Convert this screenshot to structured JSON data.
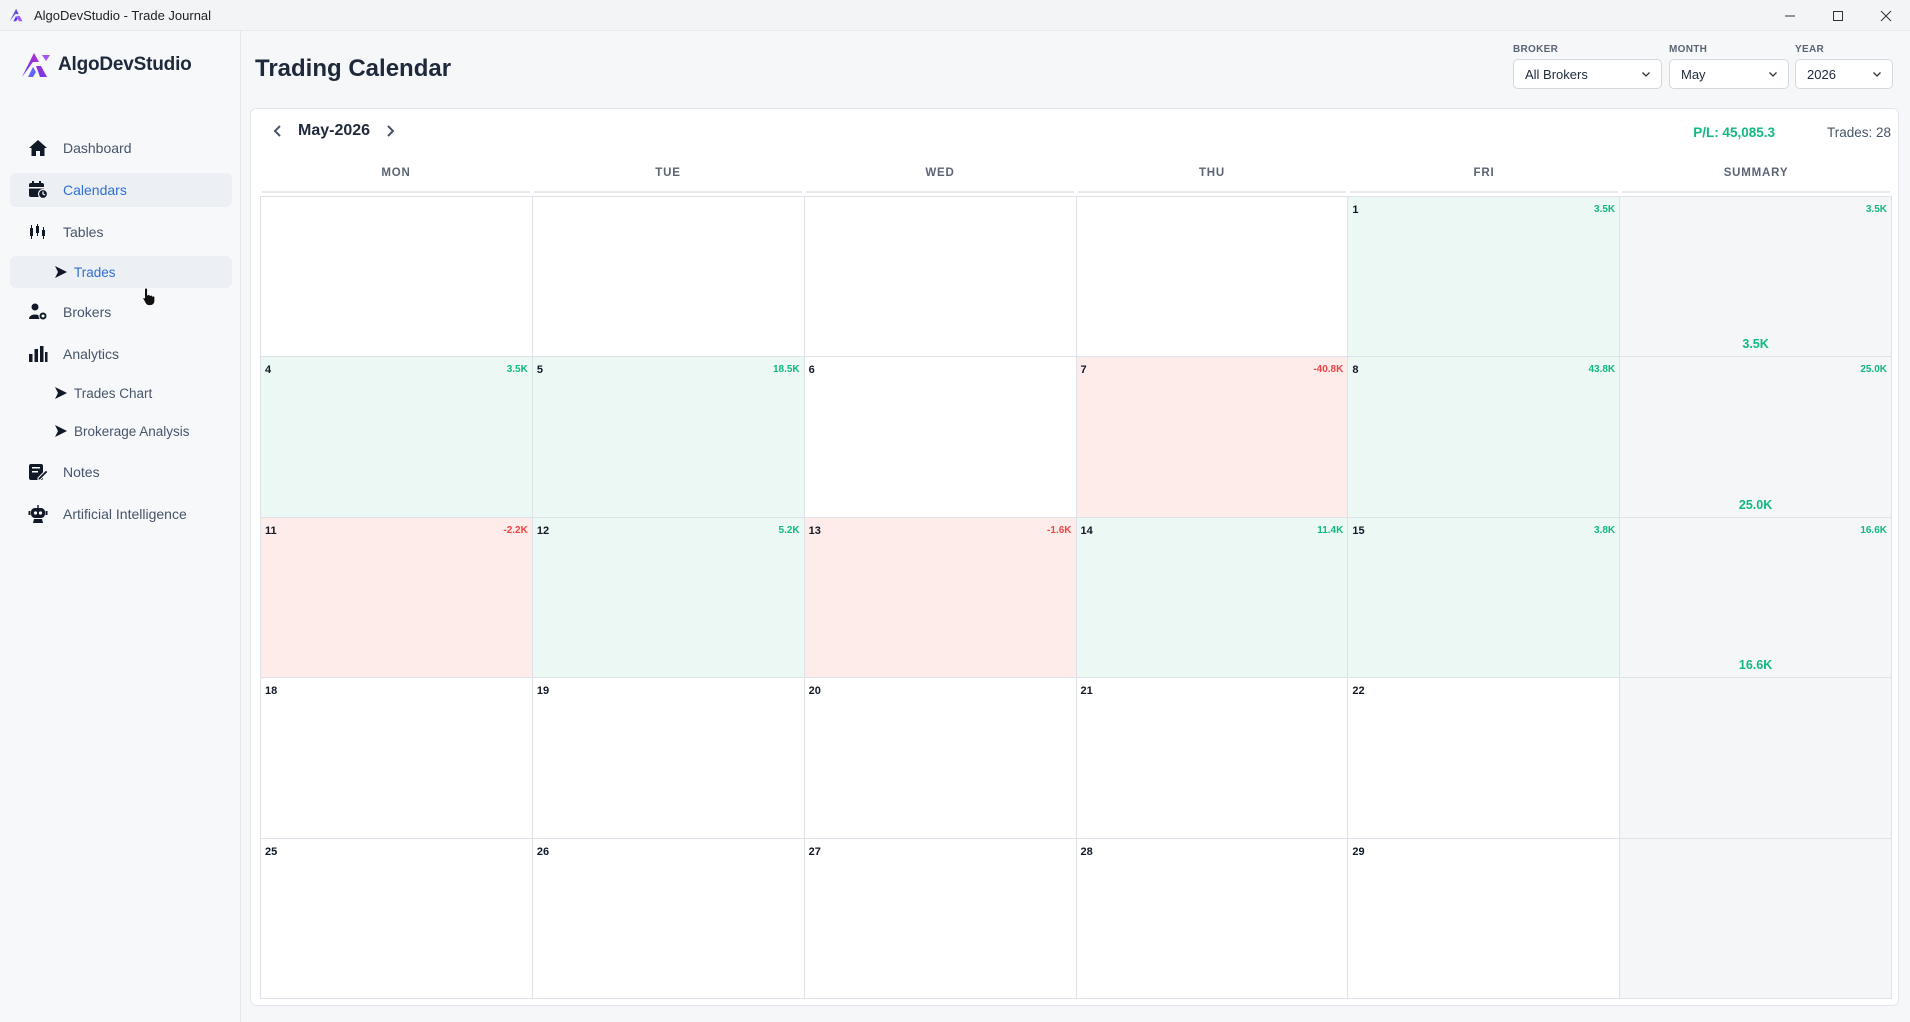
{
  "window": {
    "title": "AlgoDevStudio - Trade Journal"
  },
  "brand": {
    "name": "AlgoDevStudio"
  },
  "sidebar": {
    "items": [
      {
        "label": "Dashboard"
      },
      {
        "label": "Calendars"
      },
      {
        "label": "Tables"
      },
      {
        "label": "Trades"
      },
      {
        "label": "Brokers"
      },
      {
        "label": "Analytics"
      },
      {
        "label": "Trades Chart"
      },
      {
        "label": "Brokerage Analysis"
      },
      {
        "label": "Notes"
      },
      {
        "label": "Artificial Intelligence"
      }
    ]
  },
  "header": {
    "title": "Trading Calendar"
  },
  "filters": {
    "broker": {
      "label": "BROKER",
      "value": "All Brokers"
    },
    "month": {
      "label": "MONTH",
      "value": "May"
    },
    "year": {
      "label": "YEAR",
      "value": "2026"
    }
  },
  "calendar": {
    "month_label": "May-2026",
    "pl": "P/L: 45,085.3",
    "trades": "Trades: 28",
    "days_of_week": [
      "MON",
      "TUE",
      "WED",
      "THU",
      "FRI",
      "SUMMARY"
    ],
    "weeks": [
      {
        "days": [
          {
            "day": "",
            "value": "",
            "status": "empty"
          },
          {
            "day": "",
            "value": "",
            "status": "empty"
          },
          {
            "day": "",
            "value": "",
            "status": "empty"
          },
          {
            "day": "",
            "value": "",
            "status": "empty"
          },
          {
            "day": "1",
            "value": "3.5K",
            "status": "pos"
          }
        ],
        "summary": {
          "top": "3.5K",
          "bottom": "3.5K"
        }
      },
      {
        "days": [
          {
            "day": "4",
            "value": "3.5K",
            "status": "pos"
          },
          {
            "day": "5",
            "value": "18.5K",
            "status": "pos"
          },
          {
            "day": "6",
            "value": "",
            "status": "empty"
          },
          {
            "day": "7",
            "value": "-40.8K",
            "status": "neg"
          },
          {
            "day": "8",
            "value": "43.8K",
            "status": "pos"
          }
        ],
        "summary": {
          "top": "25.0K",
          "bottom": "25.0K"
        }
      },
      {
        "days": [
          {
            "day": "11",
            "value": "-2.2K",
            "status": "neg"
          },
          {
            "day": "12",
            "value": "5.2K",
            "status": "pos"
          },
          {
            "day": "13",
            "value": "-1.6K",
            "status": "neg"
          },
          {
            "day": "14",
            "value": "11.4K",
            "status": "pos"
          },
          {
            "day": "15",
            "value": "3.8K",
            "status": "pos"
          }
        ],
        "summary": {
          "top": "16.6K",
          "bottom": "16.6K"
        }
      },
      {
        "days": [
          {
            "day": "18",
            "value": "",
            "status": "empty"
          },
          {
            "day": "19",
            "value": "",
            "status": "empty"
          },
          {
            "day": "20",
            "value": "",
            "status": "empty"
          },
          {
            "day": "21",
            "value": "",
            "status": "empty"
          },
          {
            "day": "22",
            "value": "",
            "status": "empty"
          }
        ],
        "summary": {
          "top": "",
          "bottom": ""
        }
      },
      {
        "days": [
          {
            "day": "25",
            "value": "",
            "status": "empty"
          },
          {
            "day": "26",
            "value": "",
            "status": "empty"
          },
          {
            "day": "27",
            "value": "",
            "status": "empty"
          },
          {
            "day": "28",
            "value": "",
            "status": "empty"
          },
          {
            "day": "29",
            "value": "",
            "status": "empty"
          }
        ],
        "summary": {
          "top": "",
          "bottom": ""
        }
      }
    ]
  },
  "colors": {
    "accent": "#2f6fd6",
    "positive": "#10b981",
    "negative": "#ef4444",
    "positive_bg": "#ecf8f3",
    "negative_bg": "#fdecea"
  }
}
